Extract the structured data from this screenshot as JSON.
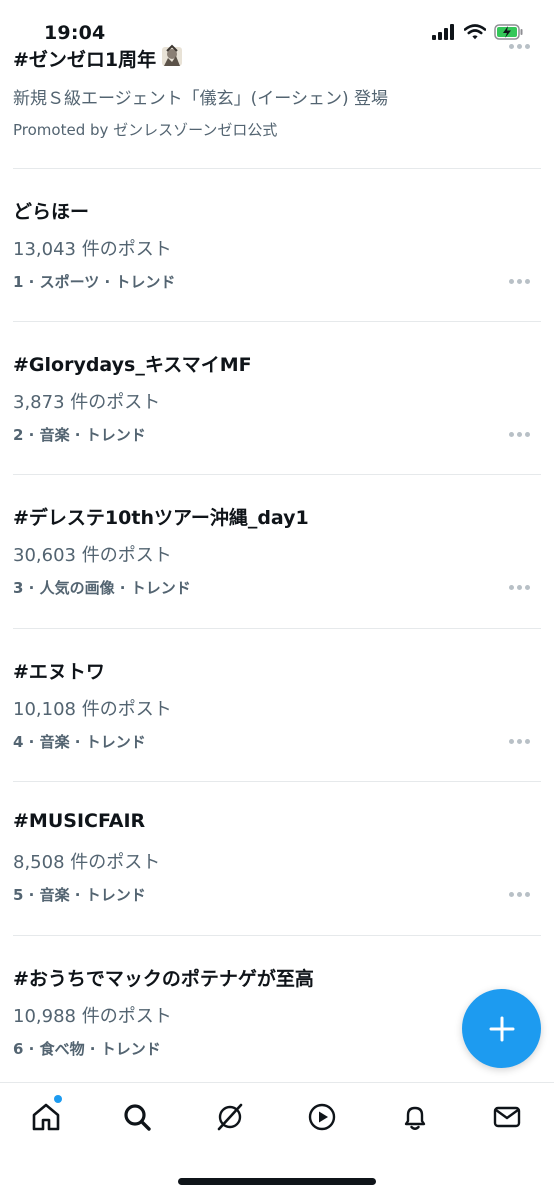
{
  "status_bar": {
    "time": "19:04",
    "battery": "charging"
  },
  "promoted": {
    "title": "#ゼンゼロ1周年",
    "description": "新規Ｓ級エージェント「儀玄」(イーシェン) 登場",
    "promoted_by": "Promoted by ゼンレスゾーンゼロ公式",
    "more_icon": "more-horizontal-icon"
  },
  "trends": [
    {
      "title": "どらほー",
      "count": "13,043 件のポスト",
      "meta": "1 · スポーツ · トレンド"
    },
    {
      "title": "#Glorydays_キスマイMF",
      "count": "3,873 件のポスト",
      "meta": "2 · 音楽 · トレンド"
    },
    {
      "title": "#デレステ10thツアー沖縄_day1",
      "count": "30,603 件のポスト",
      "meta": "3 · 人気の画像 · トレンド"
    },
    {
      "title": "#エヌトワ",
      "count": "10,108 件のポスト",
      "meta": "4 · 音楽 · トレンド"
    },
    {
      "title": "#MUSICFAIR",
      "count": "8,508 件のポスト",
      "meta": "5 · 音楽 · トレンド"
    },
    {
      "title": "#おうちでマックのポテナゲが至高",
      "count": "10,988 件のポスト",
      "meta": "6 · 食べ物 · トレンド"
    }
  ],
  "fab": {
    "icon": "plus-icon"
  },
  "tabbar": {
    "items": [
      {
        "name": "home",
        "icon": "home-icon",
        "has_badge": true
      },
      {
        "name": "search",
        "icon": "search-icon"
      },
      {
        "name": "grok",
        "icon": "grok-icon"
      },
      {
        "name": "video",
        "icon": "play-icon"
      },
      {
        "name": "notifications",
        "icon": "bell-icon"
      },
      {
        "name": "messages",
        "icon": "mail-icon"
      }
    ]
  },
  "colors": {
    "accent": "#1d9bf0",
    "text": "#0f1419",
    "secondary": "#536471",
    "divider": "#e6e9eb"
  }
}
